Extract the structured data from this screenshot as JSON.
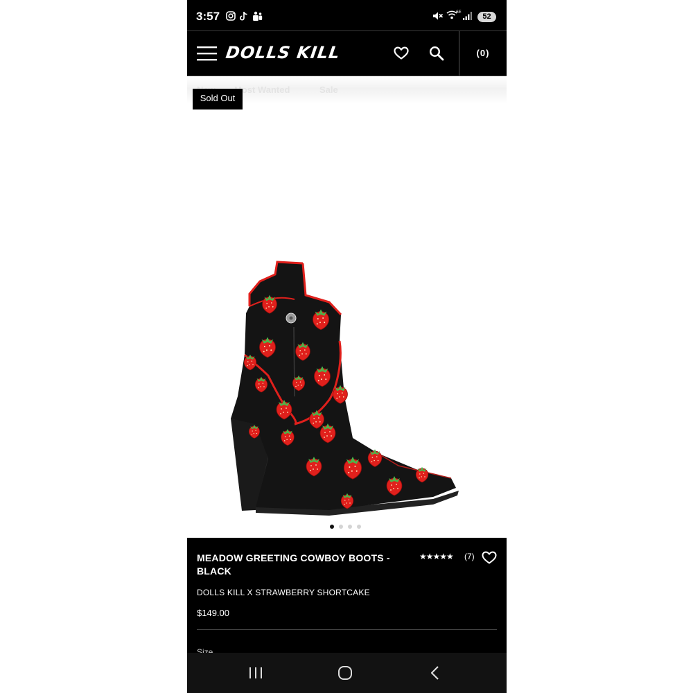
{
  "status_bar": {
    "time": "3:57",
    "battery": "52",
    "network": "6E"
  },
  "header": {
    "logo_text": "DOLLS KILL",
    "cart_count": "(0)"
  },
  "nav": {
    "links": [
      "New",
      "Most Wanted",
      "Sale"
    ]
  },
  "badge": {
    "label": "Sold Out"
  },
  "carousel": {
    "total": 4,
    "active": 1
  },
  "product": {
    "title": "MEADOW GREETING COWBOY BOOTS - BLACK",
    "brand_line": "DOLLS KILL X STRAWBERRY SHORTCAKE",
    "price": "$149.00",
    "rating_stars": "★★★★★",
    "rating": 4.5,
    "review_count": "(7)",
    "size_label": "Size"
  },
  "colors": {
    "header_bg": "#000000",
    "accent_red": "#e0201c",
    "boot_black": "#141414",
    "leaf_green": "#4fb34a"
  }
}
